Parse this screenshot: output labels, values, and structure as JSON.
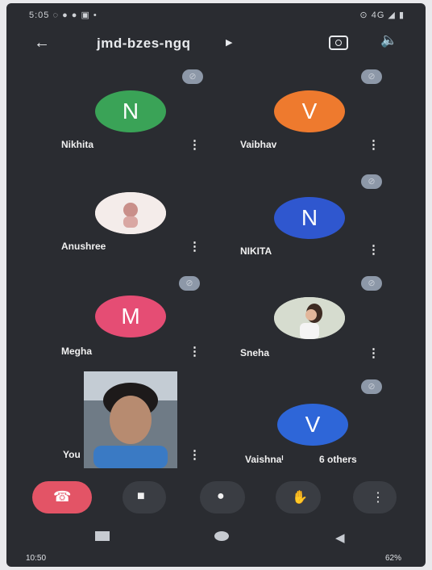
{
  "status_bar": {
    "time": "5:05",
    "left_icons": "◌ ● ● ▣ •",
    "right_info": "⊙ 4G ◢ ▮"
  },
  "header": {
    "title": "jmd-bzes-ngq"
  },
  "participants": [
    {
      "name": "Nikhita",
      "initial": "N",
      "color": "#3aa357",
      "photo": false,
      "muted": true
    },
    {
      "name": "Vaibhav",
      "initial": "V",
      "color": "#ee7a2e",
      "photo": false,
      "muted": true
    },
    {
      "name": "Anushree",
      "initial": "",
      "color": "#f4ecea",
      "photo": true,
      "muted": false
    },
    {
      "name": "NIKITA",
      "initial": "N",
      "color": "#2f57cf",
      "photo": false,
      "muted": true
    },
    {
      "name": "Megha",
      "initial": "M",
      "color": "#e54d74",
      "photo": false,
      "muted": true
    },
    {
      "name": "Sneha",
      "initial": "",
      "color": "#d8ded4",
      "photo": true,
      "muted": true
    },
    {
      "name": "You",
      "initial": "",
      "color": "#7d8894",
      "photo": true,
      "muted": false
    },
    {
      "name": "Vaishnaᴵ",
      "initial": "V",
      "color": "#2e66d8",
      "photo": false,
      "muted": true
    }
  ],
  "others_label": "6 others",
  "controls": {
    "end_call": "end-call",
    "camera": "camera",
    "mic": "mic",
    "raise_hand": "raise-hand",
    "more": "more"
  },
  "bottom_status": {
    "left": "10:50",
    "right": "62%"
  }
}
